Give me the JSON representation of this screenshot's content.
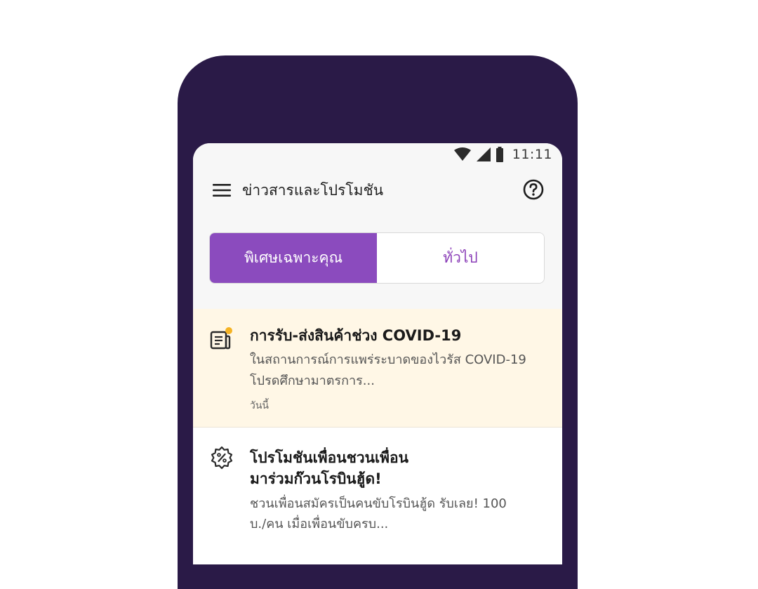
{
  "status_bar": {
    "time": "11:11",
    "icons": [
      "wifi-icon",
      "signal-icon",
      "battery-icon"
    ]
  },
  "app_bar": {
    "title": "ข่าวสารและโปรโมชัน",
    "menu_icon": "hamburger-menu-icon",
    "help_icon": "help-circle-icon"
  },
  "tabs": [
    {
      "label": "พิเศษเฉพาะคุณ",
      "active": true
    },
    {
      "label": "ทั่วไป",
      "active": false
    }
  ],
  "news": [
    {
      "icon": "news-document-icon",
      "unread": true,
      "title": "การรับ-ส่งสินค้าช่วง COVID-19",
      "body_line1": "ในสถานการณ์การแพร่ระบาดของไวรัส COVID-19",
      "body_line2": "โปรดศึกษามาตรการ...",
      "date": "วันนี้"
    },
    {
      "icon": "discount-badge-icon",
      "unread": false,
      "title_line1": "โปรโมชันเพื่อนชวนเพื่อน",
      "title_line2": "มาร่วมก๊วนโรบินฮู้ด!",
      "body_line1": "ชวนเพื่อนสมัครเป็นคนขับโรบินฮู้ด รับเลย! 100",
      "body_line2": "บ./คน เมื่อเพื่อนขับครบ..."
    }
  ],
  "colors": {
    "phone_frame": "#2a1a47",
    "accent": "#8b4bbe",
    "highlight_bg": "#fff7e6",
    "unread_dot": "#f5b324"
  }
}
